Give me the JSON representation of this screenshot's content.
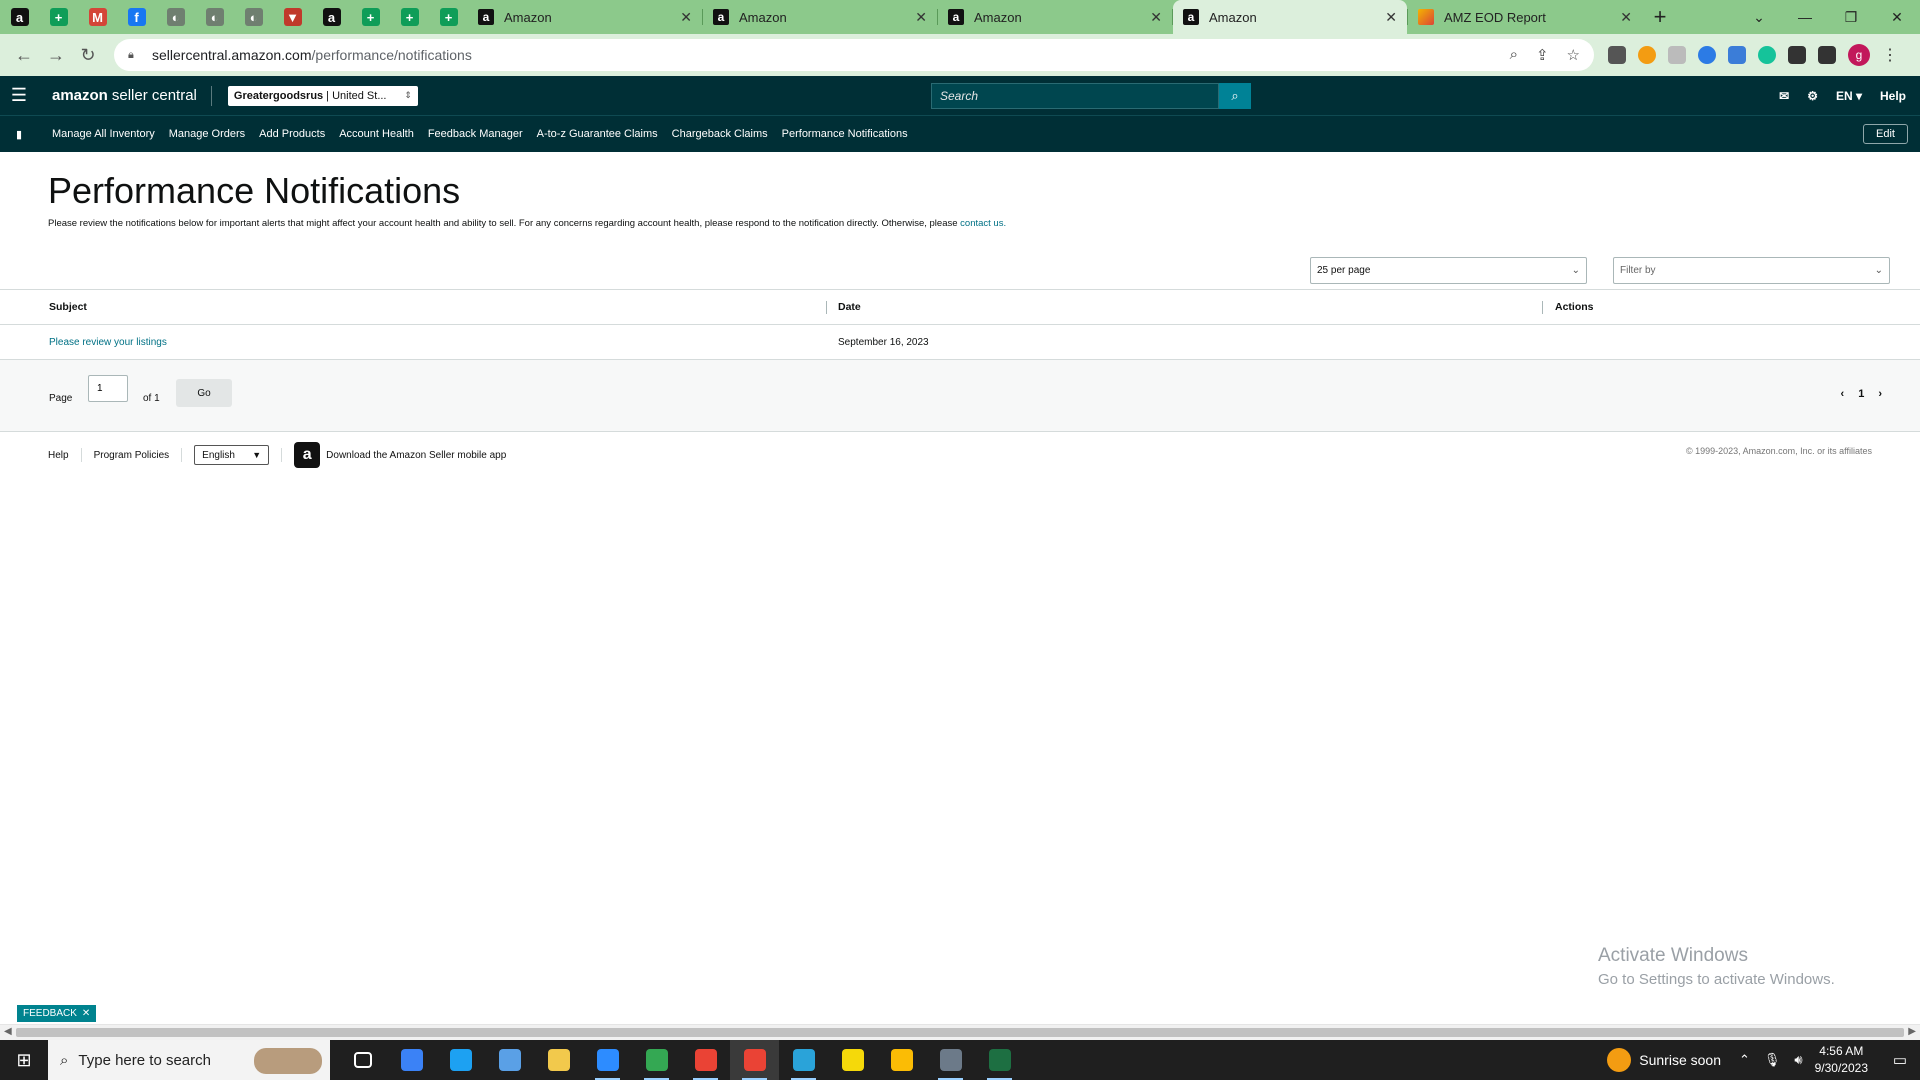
{
  "browser": {
    "pinned_tabs": [
      {
        "icon": "amazon-icon",
        "glyph": "a",
        "bg": "#111111"
      },
      {
        "icon": "sheets-icon",
        "glyph": "+",
        "bg": "#0f9d58"
      },
      {
        "icon": "gmail-icon",
        "glyph": "M",
        "bg": "#d44638"
      },
      {
        "icon": "facebook-icon",
        "glyph": "f",
        "bg": "#1877f2"
      },
      {
        "icon": "globe-icon",
        "glyph": "◐",
        "bg": "#6f7f70"
      },
      {
        "icon": "globe-icon",
        "glyph": "◐",
        "bg": "#6f7f70"
      },
      {
        "icon": "globe-icon",
        "glyph": "◐",
        "bg": "#6f7f70"
      },
      {
        "icon": "shield-icon",
        "glyph": "▼",
        "bg": "#c0392b"
      },
      {
        "icon": "amazon-icon",
        "glyph": "a",
        "bg": "#111111"
      },
      {
        "icon": "sheets-icon",
        "glyph": "+",
        "bg": "#0f9d58"
      },
      {
        "icon": "sheets-icon",
        "glyph": "+",
        "bg": "#0f9d58"
      },
      {
        "icon": "sheets-icon",
        "glyph": "+",
        "bg": "#0f9d58"
      }
    ],
    "tabs": [
      {
        "title": "Amazon",
        "active": false
      },
      {
        "title": "Amazon",
        "active": false
      },
      {
        "title": "Amazon",
        "active": false
      },
      {
        "title": "Amazon",
        "active": true
      },
      {
        "title": "AMZ EOD Report",
        "active": false
      }
    ],
    "url_host": "sellercentral.amazon.com",
    "url_path": "/performance/notifications",
    "profile_initial": "g"
  },
  "header": {
    "logo_bold": "amazon",
    "logo_rest": "seller central",
    "account_name": "Greatergoodsrus",
    "account_region": "| United St...",
    "search_placeholder": "Search",
    "language": "EN ▾",
    "help": "Help"
  },
  "nav": {
    "links": [
      "Manage All Inventory",
      "Manage Orders",
      "Add Products",
      "Account Health",
      "Feedback Manager",
      "A-to-z Guarantee Claims",
      "Chargeback Claims",
      "Performance Notifications"
    ],
    "edit_label": "Edit"
  },
  "page": {
    "title": "Performance Notifications",
    "description": "Please review the notifications below for important alerts that might affect your account health and ability to sell. For any concerns regarding account health, please respond to the notification directly. Otherwise, please",
    "contact_link": "contact us.",
    "per_page": "25 per page",
    "filter_placeholder": "Filter by"
  },
  "table": {
    "headers": {
      "subject": "Subject",
      "date": "Date",
      "actions": "Actions"
    },
    "rows": [
      {
        "subject": "Please review your listings",
        "date": "September 16, 2023",
        "actions": ""
      }
    ]
  },
  "pagination": {
    "page_label": "Page",
    "current_page": "1",
    "of_label": "of 1",
    "go_label": "Go",
    "nav_page": "1"
  },
  "footer": {
    "help": "Help",
    "program_policies": "Program Policies",
    "language": "English",
    "app_download": "Download the Amazon Seller mobile app",
    "copyright": "© 1999-2023, Amazon.com, Inc. or its affiliates"
  },
  "watermark": {
    "line1": "Activate Windows",
    "line2": "Go to Settings to activate Windows."
  },
  "feedback_label": "FEEDBACK",
  "taskbar": {
    "search_placeholder": "Type here to search",
    "weather": "Sunrise soon",
    "time": "4:56 AM",
    "date": "9/30/2023",
    "apps": [
      {
        "icon": "task-view-icon",
        "color": "#ffffff",
        "on": false
      },
      {
        "icon": "store-icon",
        "color": "#3b82f6",
        "on": false
      },
      {
        "icon": "edge-icon",
        "color": "#1da1f2",
        "on": false
      },
      {
        "icon": "mail-icon",
        "color": "#5aa0e6",
        "on": false
      },
      {
        "icon": "file-explorer-icon",
        "color": "#f2c94c",
        "on": false
      },
      {
        "icon": "zoom-icon",
        "color": "#2d8cff",
        "on": true
      },
      {
        "icon": "chrome-icon",
        "color": "#34a853",
        "on": true
      },
      {
        "icon": "chrome-icon",
        "color": "#ea4335",
        "on": true
      },
      {
        "icon": "chrome-icon",
        "color": "#ea4335",
        "on": true,
        "current": true
      },
      {
        "icon": "telegram-icon",
        "color": "#2aa3d9",
        "on": true
      },
      {
        "icon": "sticky-notes-icon",
        "color": "#f5d90a",
        "on": false
      },
      {
        "icon": "chrome-icon",
        "color": "#fbbc05",
        "on": false
      },
      {
        "icon": "calculator-icon",
        "color": "#6c7a89",
        "on": true
      },
      {
        "icon": "excel-icon",
        "color": "#1d6f42",
        "on": true
      }
    ]
  }
}
